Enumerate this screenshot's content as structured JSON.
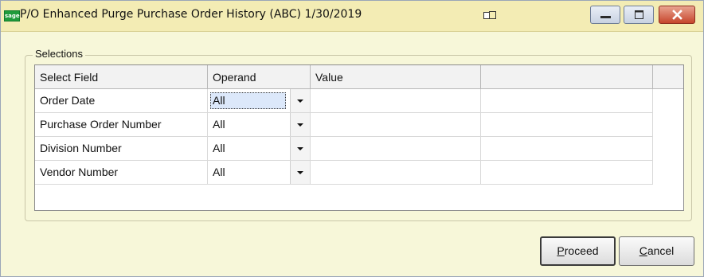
{
  "window": {
    "app_icon_text": "sage",
    "title": "P/O Enhanced Purge Purchase Order History (ABC) 1/30/2019"
  },
  "group": {
    "label": "Selections"
  },
  "grid": {
    "columns": [
      "Select Field",
      "Operand",
      "Value",
      ""
    ],
    "rows": [
      {
        "field": "Order Date",
        "operand": "All",
        "value": "",
        "extra": ""
      },
      {
        "field": "Purchase Order Number",
        "operand": "All",
        "value": "",
        "extra": ""
      },
      {
        "field": "Division Number",
        "operand": "All",
        "value": "",
        "extra": ""
      },
      {
        "field": "Vendor Number",
        "operand": "All",
        "value": "",
        "extra": ""
      }
    ]
  },
  "buttons": {
    "proceed": {
      "mnemonic": "P",
      "rest": "roceed"
    },
    "cancel": {
      "mnemonic": "C",
      "rest": "ancel"
    }
  },
  "icons": {
    "app": "sage-logo-icon",
    "restore": "window-restore-icon",
    "minimize": "minimize-icon",
    "maximize": "maximize-icon",
    "close": "close-icon",
    "dropdown": "chevron-down-icon"
  },
  "colors": {
    "title_bar": "#f3ecb4",
    "window_bg": "#f7f7d9",
    "close_button": "#c6452c",
    "focused_cell": "#dce8fa"
  }
}
